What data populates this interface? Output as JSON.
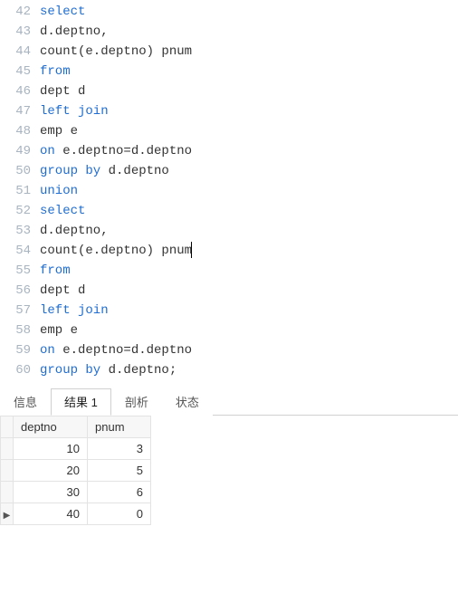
{
  "editor": {
    "lines": [
      {
        "num": 42,
        "tokens": [
          {
            "t": "select",
            "c": "kw"
          }
        ]
      },
      {
        "num": 43,
        "tokens": [
          {
            "t": "d.deptno,",
            "c": "txt"
          }
        ]
      },
      {
        "num": 44,
        "tokens": [
          {
            "t": "count(e.deptno) pnum",
            "c": "txt"
          }
        ]
      },
      {
        "num": 45,
        "tokens": [
          {
            "t": "from",
            "c": "kw"
          }
        ]
      },
      {
        "num": 46,
        "tokens": [
          {
            "t": "dept d",
            "c": "txt"
          }
        ]
      },
      {
        "num": 47,
        "tokens": [
          {
            "t": "left join",
            "c": "kw"
          }
        ]
      },
      {
        "num": 48,
        "tokens": [
          {
            "t": "emp e",
            "c": "txt"
          }
        ]
      },
      {
        "num": 49,
        "tokens": [
          {
            "t": "on ",
            "c": "kw"
          },
          {
            "t": "e.deptno=d.deptno",
            "c": "txt"
          }
        ]
      },
      {
        "num": 50,
        "tokens": [
          {
            "t": "group by ",
            "c": "kw"
          },
          {
            "t": "d.deptno",
            "c": "txt"
          }
        ]
      },
      {
        "num": 51,
        "tokens": [
          {
            "t": "union",
            "c": "kw"
          }
        ]
      },
      {
        "num": 52,
        "tokens": [
          {
            "t": "select",
            "c": "kw"
          }
        ]
      },
      {
        "num": 53,
        "tokens": [
          {
            "t": "d.deptno,",
            "c": "txt"
          }
        ]
      },
      {
        "num": 54,
        "tokens": [
          {
            "t": "count(e.deptno) pnum",
            "c": "txt"
          }
        ],
        "cursor": true
      },
      {
        "num": 55,
        "tokens": [
          {
            "t": "from",
            "c": "kw"
          }
        ]
      },
      {
        "num": 56,
        "tokens": [
          {
            "t": "dept d",
            "c": "txt"
          }
        ]
      },
      {
        "num": 57,
        "tokens": [
          {
            "t": "left join",
            "c": "kw"
          }
        ]
      },
      {
        "num": 58,
        "tokens": [
          {
            "t": "emp e",
            "c": "txt"
          }
        ]
      },
      {
        "num": 59,
        "tokens": [
          {
            "t": "on ",
            "c": "kw"
          },
          {
            "t": "e.deptno=d.deptno",
            "c": "txt"
          }
        ]
      },
      {
        "num": 60,
        "tokens": [
          {
            "t": "group by ",
            "c": "kw"
          },
          {
            "t": "d.deptno;",
            "c": "txt"
          }
        ]
      }
    ]
  },
  "tabs": {
    "items": [
      {
        "label": "信息",
        "active": false
      },
      {
        "label": "结果 1",
        "active": true
      },
      {
        "label": "剖析",
        "active": false
      },
      {
        "label": "状态",
        "active": false
      }
    ]
  },
  "result": {
    "columns": [
      "deptno",
      "pnum"
    ],
    "rows": [
      {
        "deptno": 10,
        "pnum": 3,
        "current": false
      },
      {
        "deptno": 20,
        "pnum": 5,
        "current": false
      },
      {
        "deptno": 30,
        "pnum": 6,
        "current": false
      },
      {
        "deptno": 40,
        "pnum": 0,
        "current": true
      }
    ],
    "current_marker": "▶"
  }
}
